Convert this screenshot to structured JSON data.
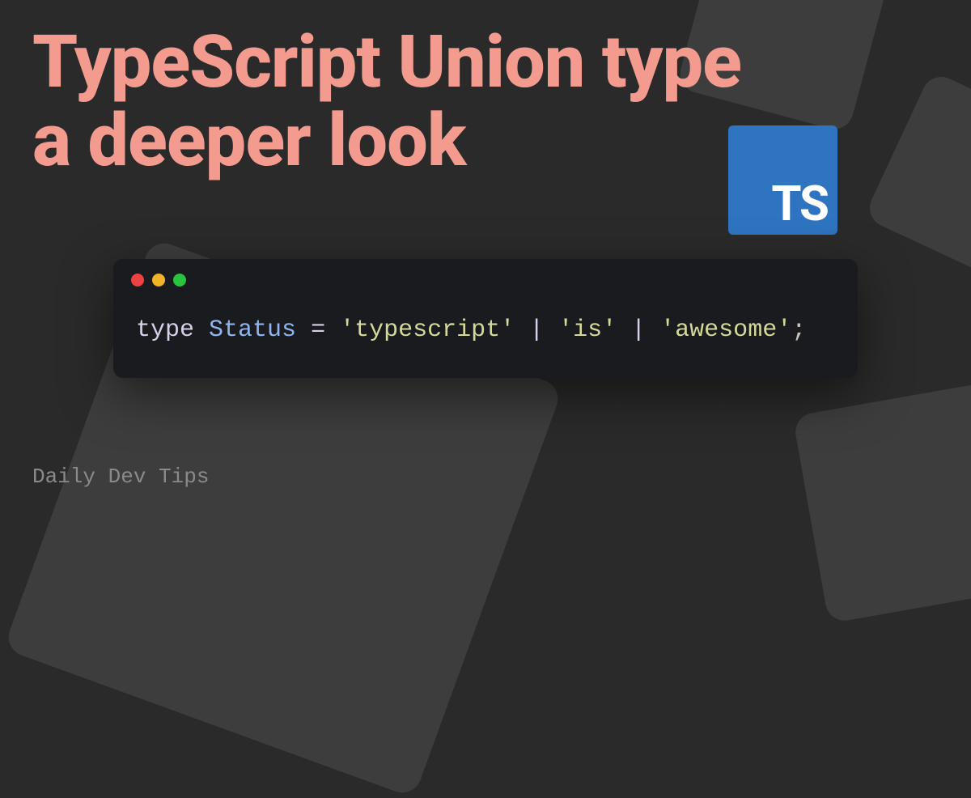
{
  "title": "TypeScript Union type a deeper look",
  "logo": {
    "text": "TS",
    "bg_color": "#2f74c0"
  },
  "code": {
    "tokens": {
      "keyword": "type",
      "type_name": "Status",
      "equals": " = ",
      "str1": "'typescript'",
      "pipe1": " | ",
      "str2": "'is'",
      "pipe2": " | ",
      "str3": "'awesome'",
      "semi": ";"
    }
  },
  "footer": "Daily Dev Tips",
  "colors": {
    "title": "#f39b8f",
    "bg": "#2a2a2a",
    "code_bg": "#1a1b1e"
  }
}
